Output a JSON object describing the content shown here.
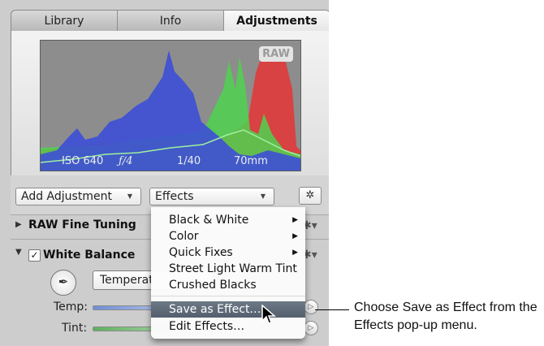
{
  "tabs": [
    "Library",
    "Info",
    "Adjustments"
  ],
  "histogram": {
    "badge": "RAW",
    "iso": "ISO 640",
    "aperture": "ƒ/4",
    "shutter": "1/40",
    "focal": "70mm"
  },
  "toolbar": {
    "add_adjustment": "Add Adjustment",
    "effects": "Effects"
  },
  "sections": {
    "raw_fine_tuning": "RAW Fine Tuning",
    "white_balance": "White Balance",
    "white_balance_checked": "✓",
    "temperature_partial": "Temperat",
    "temp_label": "Temp:",
    "tint_label": "Tint:"
  },
  "menu": {
    "items": [
      "Black & White",
      "Color",
      "Quick Fixes",
      "Street Light Warm Tint",
      "Crushed Blacks",
      "Save as Effect…",
      "Edit Effects…"
    ],
    "highlighted": "Save as Effect…"
  },
  "callout": "Choose Save as Effect from the Effects pop-up menu.",
  "colors": {
    "highlight": "#5c6776",
    "histogram_blue": "#3d4fd6",
    "histogram_green": "#4fd24f",
    "histogram_red": "#e03a3a"
  }
}
